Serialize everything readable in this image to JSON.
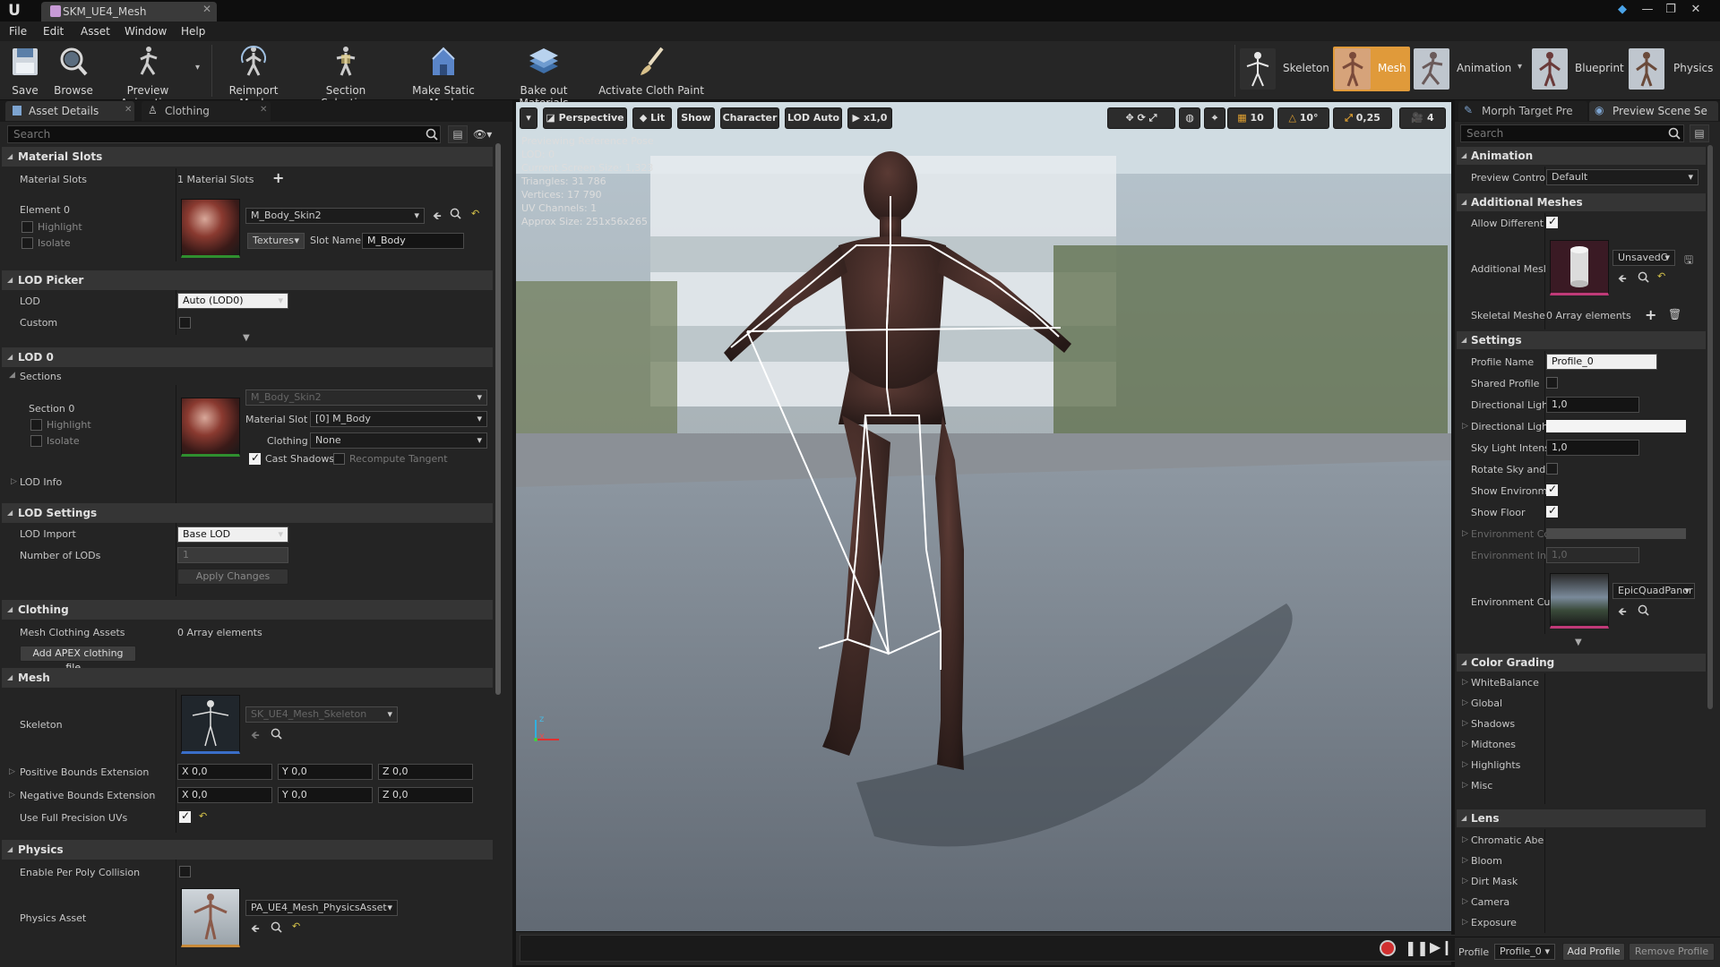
{
  "window": {
    "tab_title": "SKM_UE4_Mesh",
    "logo": "U",
    "close": "✕",
    "min": "—",
    "restore": "❐",
    "x": "✕"
  },
  "menu": [
    "File",
    "Edit",
    "Asset",
    "Window",
    "Help"
  ],
  "toolbar": {
    "save": "Save",
    "browse": "Browse",
    "preview_animation": "Preview Animation",
    "reimport_mesh": "Reimport Mesh",
    "section_selection": "Section Selection",
    "make_static_mesh": "Make Static Mesh",
    "bake_out_materials": "Bake out Materials",
    "activate_cloth_paint": "Activate Cloth Paint"
  },
  "modes": {
    "skeleton": "Skeleton",
    "mesh": "Mesh",
    "animation": "Animation",
    "blueprint": "Blueprint",
    "physics": "Physics"
  },
  "left_panel": {
    "tabs": [
      "Asset Details",
      "Clothing"
    ],
    "search_placeholder": "Search",
    "material_slots": {
      "header": "Material Slots",
      "label": "Material Slots",
      "count": "1 Material Slots",
      "element": "Element 0",
      "highlight": "Highlight",
      "isolate": "Isolate",
      "material": "M_Body_Skin2",
      "textures": "Textures",
      "slot_name_label": "Slot Name",
      "slot_name": "M_Body"
    },
    "lod_picker": {
      "header": "LOD Picker",
      "lod_label": "LOD",
      "lod_value": "Auto (LOD0)",
      "custom": "Custom"
    },
    "lod0": {
      "header": "LOD 0",
      "sections": "Sections",
      "section": "Section 0",
      "highlight": "Highlight",
      "isolate": "Isolate",
      "material": "M_Body_Skin2",
      "material_slot_label": "Material Slot",
      "material_slot": "[0] M_Body",
      "clothing_label": "Clothing",
      "clothing": "None",
      "cast_shadows": "Cast Shadows",
      "recompute_tangent": "Recompute Tangent",
      "lod_info": "LOD Info"
    },
    "lod_settings": {
      "header": "LOD Settings",
      "lod_import": "LOD Import",
      "lod_import_value": "Base LOD",
      "num_lods": "Number of LODs",
      "num_lods_value": "1",
      "apply": "Apply Changes"
    },
    "clothing": {
      "header": "Clothing",
      "assets_label": "Mesh Clothing Assets",
      "assets_value": "0 Array elements",
      "add_apex": "Add APEX clothing file..."
    },
    "mesh": {
      "header": "Mesh",
      "skeleton_label": "Skeleton",
      "skeleton_value": "SK_UE4_Mesh_Skeleton",
      "pos_bounds": "Positive Bounds Extension",
      "neg_bounds": "Negative Bounds Extension",
      "x": "X",
      "y": "Y",
      "z": "Z",
      "zero": "0,0",
      "full_precision": "Use Full Precision UVs"
    },
    "physics": {
      "header": "Physics",
      "per_poly": "Enable Per Poly Collision",
      "asset_label": "Physics Asset",
      "asset_value": "PA_UE4_Mesh_PhysicsAsset"
    }
  },
  "viewport": {
    "perspective": "Perspective",
    "lit": "Lit",
    "show": "Show",
    "character": "Character",
    "lod_auto": "LOD Auto",
    "speed": "x1,0",
    "grid": "10",
    "angle": "10°",
    "scale": "0,25",
    "cam_speed": "4",
    "info": [
      "Previewing Reference Pose",
      "LOD: 0",
      "Current Screen Size: 1,323",
      "Triangles: 31 786",
      "Vertices: 17 790",
      "UV Channels: 1",
      "Approx Size: 251x56x265"
    ],
    "axis_x": "x",
    "axis_z": "z"
  },
  "right_panel": {
    "tabs": [
      "Morph Target Pre",
      "Preview Scene Se"
    ],
    "search_placeholder": "Search",
    "animation": {
      "header": "Animation",
      "preview_label": "Preview Contro",
      "preview_value": "Default"
    },
    "additional": {
      "header": "Additional Meshes",
      "allow_diff": "Allow Different",
      "additional_mesh": "Additional Mesl",
      "unsaved": "UnsavedC",
      "skeletal_meshes": "Skeletal Meshe",
      "skeletal_value": "0 Array elements"
    },
    "settings": {
      "header": "Settings",
      "profile_name": "Profile Name",
      "profile_value": "Profile_0",
      "shared_profile": "Shared Profile",
      "dir_light": "Directional Ligh",
      "dir_light_value": "1,0",
      "dir_light2": "Directional Ligh",
      "sky_light": "Sky Light Intens",
      "sky_light_value": "1,0",
      "rotate_sky": "Rotate Sky and",
      "show_env": "Show Environm",
      "show_floor": "Show Floor",
      "env_color": "Environment Cc",
      "env_int": "Environment Int",
      "env_int_value": "1,0",
      "env_cube": "Environment Cu",
      "env_cube_value": "EpicQuadPanor"
    },
    "color_grading": {
      "header": "Color Grading",
      "items": [
        "WhiteBalance",
        "Global",
        "Shadows",
        "Midtones",
        "Highlights",
        "Misc"
      ]
    },
    "lens": {
      "header": "Lens",
      "items": [
        "Chromatic Abe",
        "Bloom",
        "Dirt Mask",
        "Camera",
        "Exposure"
      ]
    },
    "footer": {
      "profile": "Profile",
      "profile_value": "Profile_0",
      "add": "Add Profile",
      "remove": "Remove Profile"
    }
  }
}
